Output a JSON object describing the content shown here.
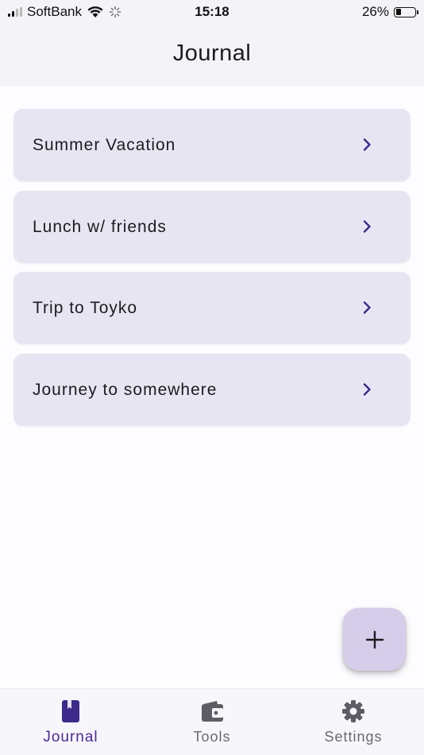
{
  "status_bar": {
    "carrier": "SoftBank",
    "time": "15:18",
    "battery": "26%",
    "battery_level": 0.26
  },
  "app_bar": {
    "title": "Journal"
  },
  "journal_entries": [
    {
      "label": "Summer Vacation",
      "icon": "chevron-right-icon"
    },
    {
      "label": "Lunch w/ friends",
      "icon": "chevron-right-icon"
    },
    {
      "label": "Trip to Toyko",
      "icon": "chevron-right-icon"
    },
    {
      "label": "Journey to somewhere",
      "icon": "chevron-right-icon"
    }
  ],
  "fab": {
    "icon": "plus-icon"
  },
  "bottom_nav": {
    "items": [
      {
        "label": "Journal",
        "icon": "book-icon",
        "active": true
      },
      {
        "label": "Tools",
        "icon": "wallet-icon",
        "active": false
      },
      {
        "label": "Settings",
        "icon": "gear-icon",
        "active": false
      }
    ]
  },
  "colors": {
    "accent": "#4b2a9a",
    "card_bg": "#e8e5f2",
    "fab_bg": "#d6cdea",
    "inactive": "#6b6874"
  }
}
